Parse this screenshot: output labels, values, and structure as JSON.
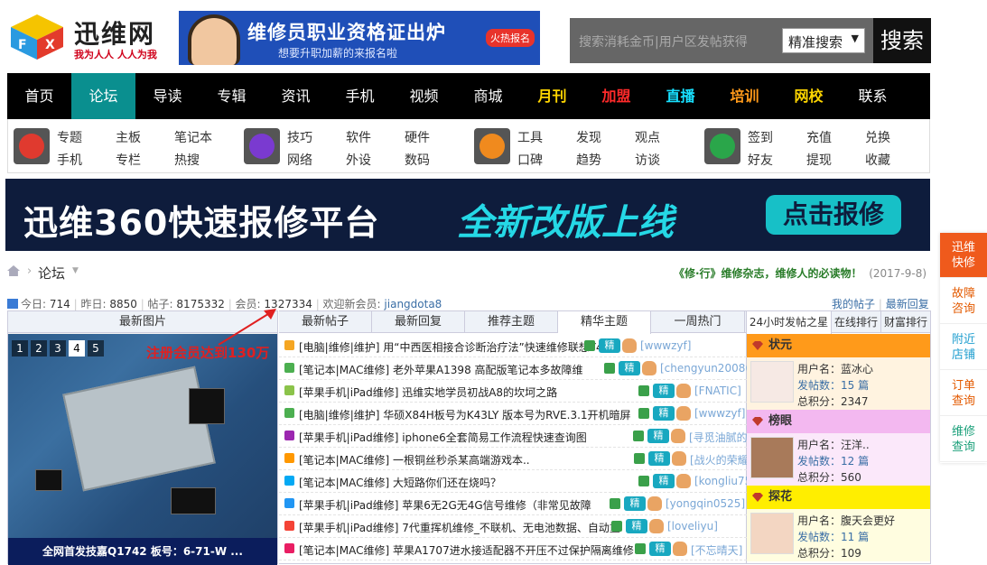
{
  "header": {
    "logo_name": "迅维网",
    "logo_slogan": "我为人人 人人为我",
    "ad_title": "维修员职业资格证出炉",
    "ad_sub": "想要升职加薪的来报名啦",
    "ad_hot": "火热报名",
    "search_placeholder": "搜索消耗金币|用户区发帖获得",
    "search_mode": "精准搜索",
    "search_button": "搜索"
  },
  "nav": [
    {
      "label": "首页",
      "color": "#ffffff"
    },
    {
      "label": "论坛",
      "color": "#ffffff",
      "active": true
    },
    {
      "label": "导读",
      "color": "#ffffff"
    },
    {
      "label": "专辑",
      "color": "#ffffff"
    },
    {
      "label": "资讯",
      "color": "#ffffff"
    },
    {
      "label": "手机",
      "color": "#ffffff"
    },
    {
      "label": "视频",
      "color": "#ffffff"
    },
    {
      "label": "商城",
      "color": "#ffffff"
    },
    {
      "label": "月刊",
      "color": "#ffd600"
    },
    {
      "label": "加盟",
      "color": "#ff2a2a"
    },
    {
      "label": "直播",
      "color": "#18e0ff"
    },
    {
      "label": "培训",
      "color": "#ff9a1a"
    },
    {
      "label": "网校",
      "color": "#ffd600"
    },
    {
      "label": "联系",
      "color": "#ffffff"
    }
  ],
  "subnav": {
    "groups": [
      {
        "icon": "home-icon",
        "color": "#e03a2f",
        "cols": [
          [
            "专题",
            "手机"
          ],
          [
            "主板",
            "专栏"
          ],
          [
            "笔记本",
            "热搜"
          ]
        ]
      },
      {
        "icon": "phone-icon",
        "color": "#7a3ad0",
        "cols": [
          [
            "技巧",
            "网络"
          ],
          [
            "软件",
            "外设"
          ],
          [
            "硬件",
            "数码"
          ]
        ]
      },
      {
        "icon": "at-icon",
        "color": "#f08a1e",
        "cols": [
          [
            "工具",
            "口碑"
          ],
          [
            "发现",
            "趋势"
          ],
          [
            "观点",
            "访谈"
          ]
        ]
      },
      {
        "icon": "user-icon",
        "color": "#2aa64a",
        "cols": [
          [
            "签到",
            "好友"
          ],
          [
            "充值",
            "提现"
          ],
          [
            "兑换",
            "收藏"
          ]
        ]
      }
    ]
  },
  "banner2": {
    "title": "迅维360快速报修平台",
    "highlight": "全新改版上线",
    "button": "点击报修"
  },
  "breadcrumb": {
    "current": "论坛"
  },
  "promo": {
    "text": "《修·行》维修杂志，维修人的必读物！",
    "date": "(2017-9-8)"
  },
  "stats": {
    "today_label": "今日:",
    "today": "714",
    "yesterday_label": "昨日:",
    "yesterday": "8850",
    "posts_label": "帖子:",
    "posts": "8175332",
    "members_label": "会员:",
    "members": "1327334",
    "welcome_label": "欢迎新会员:",
    "new_member": "jiangdota8",
    "my_posts": "我的帖子",
    "latest_reply": "最新回复"
  },
  "annotation": "注册会员达到130万",
  "photo": {
    "header": "最新图片",
    "pages": [
      "1",
      "2",
      "3",
      "4",
      "5"
    ],
    "active_page": "4",
    "caption": "全网首发技嘉Q1742 板号：6-71-W ..."
  },
  "post_tabs": [
    "最新帖子",
    "最新回复",
    "推荐主题",
    "精华主题",
    "一周热门"
  ],
  "post_tab_active": 3,
  "posts": [
    {
      "title": "[电脑|维修|维护] 用“中西医相接合诊断治疗法”快速维修联想Y430",
      "user": "[wwwzyf]",
      "color": "#f5a623"
    },
    {
      "title": "[笔记本|MAC维修] 老外苹果A1398 高配版笔记本多故障维",
      "user": "[chengyun20086]",
      "color": "#4caf50"
    },
    {
      "title": "[苹果手机|iPad维修] 迅维实地学员初战A8的坎坷之路",
      "user": "[FNATIC]",
      "color": "#8bc34a"
    },
    {
      "title": "[电脑|维修|维护] 华硕X84H板号为K43LY 版本号为RVE.3.1开机暗屏",
      "user": "[wwwzyf]",
      "color": "#4caf50"
    },
    {
      "title": "[苹果手机|iPad维修] iphone6全套简易工作流程快速查询图",
      "user": "[寻觅油腻的呱唧]",
      "color": "#9c27b0"
    },
    {
      "title": "[笔记本|MAC维修] 一根铜丝秒杀某高端游戏本..",
      "user": "[战火的荣耀]",
      "color": "#ff9800"
    },
    {
      "title": "[笔记本|MAC维修] 大短路你们还在烧吗？",
      "user": "[kongliu75]",
      "color": "#03a9f4"
    },
    {
      "title": "[苹果手机|iPad维修] 苹果6无2G无4G信号维修（非常见故障",
      "user": "[yongqin0525]",
      "color": "#2196f3"
    },
    {
      "title": "[苹果手机|iPad维修] 7代重挥机维修_不联机、无电池数据、自动重",
      "user": "[loveliyu]",
      "color": "#f44336"
    },
    {
      "title": "[笔记本|MAC维修] 苹果A1707进水接适配器不开压不过保护隔离维修",
      "user": "[不忘晴天]",
      "color": "#e91e63"
    }
  ],
  "rank_tabs": [
    "24小时发帖之星",
    "在线排行",
    "财富排行"
  ],
  "ranks": [
    {
      "title": "状元",
      "bg": "#ff9a1a",
      "body_bg": "#fff3e0",
      "user_label": "用户名：",
      "user": "蓝冰心",
      "posts_label": "发帖数：",
      "posts": "15 篇",
      "points_label": "总积分：",
      "points": "2347"
    },
    {
      "title": "榜眼",
      "bg": "#f3b8f0",
      "body_bg": "#fbe8fa",
      "user_label": "用户名：",
      "user": "汪洋..",
      "posts_label": "发帖数：",
      "posts": "12 篇",
      "points_label": "总积分：",
      "points": "560"
    },
    {
      "title": "探花",
      "bg": "#ffee00",
      "body_bg": "#fffde0",
      "user_label": "用户名：",
      "user": "腹天会更好",
      "posts_label": "发帖数：",
      "posts": "11 篇",
      "points_label": "总积分：",
      "points": "109"
    }
  ],
  "side": [
    {
      "label": "迅维快修",
      "style": "on"
    },
    {
      "label": "故障咨询",
      "style": ""
    },
    {
      "label": "附近店铺",
      "style": "blue"
    },
    {
      "label": "订单查询",
      "style": ""
    },
    {
      "label": "维修查询",
      "style": "green"
    }
  ]
}
